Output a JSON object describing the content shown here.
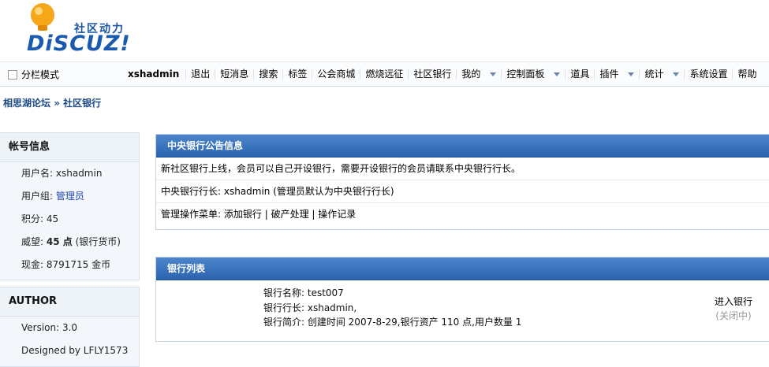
{
  "logo": {
    "slogan": "社区动力",
    "brand": "DiSCUZ!"
  },
  "menubar": {
    "split_mode": "分栏模式",
    "user": "xshadmin",
    "items": [
      "退出",
      "短消息",
      "搜索",
      "标签",
      "公会商城",
      "燃烧远征",
      "社区银行",
      "我的",
      "控制面板",
      "道具",
      "插件",
      "统计",
      "系统设置",
      "帮助"
    ]
  },
  "breadcrumb": {
    "home": "相思湖论坛",
    "sep": "»",
    "current": "社区银行"
  },
  "sidebar": {
    "account": {
      "title": "帐号信息",
      "username_label": "用户名:",
      "username": "xshadmin",
      "group_label": "用户组:",
      "group": "管理员",
      "points_label": "积分:",
      "points": "45",
      "prestige_label": "威望:",
      "prestige_value": "45 点",
      "prestige_unit": "(银行货币)",
      "cash_label": "现金:",
      "cash": "8791715 金币"
    },
    "author": {
      "title": "AUTHOR",
      "version": "Version: 3.0",
      "designer": "Designed by LFLY1573"
    }
  },
  "notice": {
    "title": "中央银行公告信息",
    "line1": "新社区银行上线，会员可以自己开设银行，需要开设银行的会员请联系中央银行行长。",
    "line2": "中央银行行长: xshadmin (管理员默认为中央银行行长)",
    "menu_label": "管理操作菜单:",
    "actions": [
      "添加银行",
      "破产处理",
      "操作记录"
    ]
  },
  "banklist": {
    "title": "银行列表",
    "name": "银行名称: test007",
    "president": "银行行长: xshadmin,",
    "intro": "银行简介: 创建时间 2007-8-29,银行资产 110 点,用户数量 1",
    "enter": "进入银行",
    "status": "(关闭中)"
  }
}
